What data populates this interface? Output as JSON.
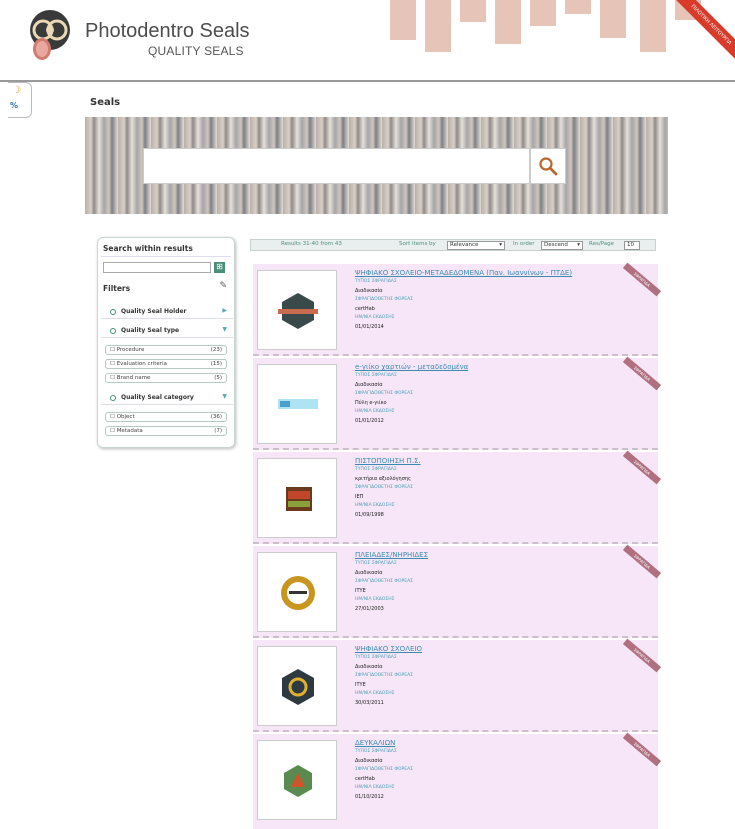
{
  "header": {
    "title": "Photodentro Seals",
    "subtitle": "QUALITY SEALS",
    "corner_ribbon": "ΠΙΛΟΤΙΚΗ ΛΕΙΤΟΥΡΓΙΑ"
  },
  "page": {
    "title": "Seals"
  },
  "search": {
    "placeholder": ""
  },
  "filters": {
    "search_within_title": "Search within results",
    "filters_title": "Filters",
    "holder_label": "Quality Seal Holder",
    "type_label": "Quality Seal type",
    "type_items": [
      {
        "label": "Procedure",
        "count": "(23)"
      },
      {
        "label": "Evaluation criteria",
        "count": "(15)"
      },
      {
        "label": "Brand name",
        "count": "(5)"
      }
    ],
    "category_label": "Quality Seal category",
    "category_items": [
      {
        "label": "Object",
        "count": "(36)"
      },
      {
        "label": "Metadata",
        "count": "(7)"
      }
    ]
  },
  "results_bar": {
    "results_text": "Results 31-40 from 43",
    "sort_label": "Sort items by",
    "sort_value": "Relevance",
    "order_label": "In order",
    "order_value": "Descend",
    "perpage_label": "Res/Page",
    "perpage_value": "10"
  },
  "field_labels": {
    "type": "ΤΥΠΟΣ ΣΦΡΑΓΙΔΑΣ",
    "issuer": "ΣΦΡΑΓΙΔΟΘΕΤΗΣ ΦΟΡΕΑΣ",
    "date": "ΗΜ/ΝΙΑ ΕΚΔΟΣΗΣ",
    "ribbon": "ΣΦΡΑΓΙΔΑ"
  },
  "results": [
    {
      "title": "ΨΗΦΙΑΚΟ ΣΧΟΛΕΙΟ-ΜΕΤΑΔΕΔΟΜΕΝΑ (Παν. Ιωαννίνων - ΠΤΔΕ)",
      "type": "Διαδικασία",
      "issuer": "certHab",
      "date": "01/01/2014"
    },
    {
      "title": "e-γιίκο χαρτιών - μεταδεδομένα",
      "type": "Διαδικασία",
      "issuer": "Πύλη e-γιίκο",
      "date": "01/01/2012"
    },
    {
      "title": "ΠΙΣΤΟΠΟΙΗΣΗ Π.Σ.",
      "type": "κριτήρια αξιολόγησης",
      "issuer": "ΙΕΠ",
      "date": "01/09/1998"
    },
    {
      "title": "ΠΛΕΙΑΔΕΣ/ΝΗΡΗΙΔΕΣ",
      "type": "Διαδικασία",
      "issuer": "ΙΤΥΕ",
      "date": "27/01/2003"
    },
    {
      "title": "ΨΗΦΙΑΚΟ ΣΧΟΛΕΙΟ",
      "type": "Διαδικασία",
      "issuer": "ΙΤΥΕ",
      "date": "30/03/2011"
    },
    {
      "title": "ΔΕΥΚΑΛΙΩΝ",
      "type": "Διαδικασία",
      "issuer": "certHab",
      "date": "01/10/2012"
    }
  ]
}
